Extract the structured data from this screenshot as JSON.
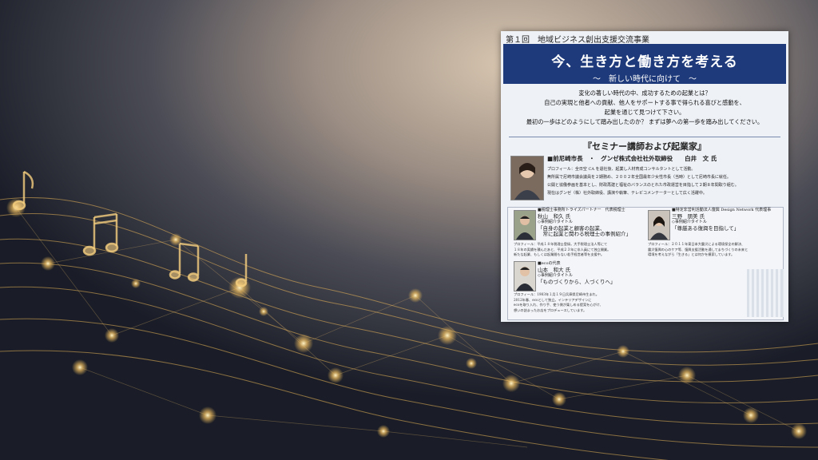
{
  "flyer": {
    "series_label": "第１回　地域ビジネス創出支援交流事業",
    "title": "今、生き方と働き方を考える",
    "subtitle": "～　新しい時代に向けて　～",
    "intro_lines": [
      "変化の著しい時代の中、成功するための起業とは？",
      "自己の実現と他者への貢献、他人をサポートする事で得られる喜びと感動を、",
      "起業を通じて見つけて下さい。",
      "最初の一歩はどのようにして踏み出したのか？ まずは夢への第一歩を踏み出してください。"
    ],
    "section_title": "『セミナー講師および起業家』",
    "main_speaker": {
      "heading": "■前尼崎市長　・　グンゼ株式会社社外取締役　　白井　文 氏",
      "profile_lines": [
        "プロフィール：全日空 CA を退社後、起業し人材育成コンサルタントとして活動。",
        "無所属で尼崎市議会議員を２期務め、２００２年全国最年少女性市長（当時）として尼崎市長に就任。",
        "公開と協働参画を基本とし、財政再建と福祉のバランスのとれた市政運営を目指して２期８年間取り組む。",
        "現在はグンゼ（株）社外取締役、講演や執筆、テレビコメンテーターとして広く活躍中。"
      ]
    },
    "speakers": [
      {
        "role": "■税理士事務所トライズパートナー　代表税理士",
        "name": "秋山　和久 氏",
        "topic_label": "◇事例紹介タイトル",
        "topic": "「自身の起業と顧客の起業、\n　常に起業と関わる税理士の事例紹介」",
        "profile": "プロフィール：平成１８年税理士登録。大手税理士法人等にて\n１８年の実績を積んだあと、平成２３年に非人員にて独立開業。\n新たな起業、もしくは起業間もない若手経営者等を支援中。"
      },
      {
        "role": "■特定非営利活動法人復興 Design Network 代表理事",
        "name": "三野　朋美 氏",
        "topic_label": "◇事例紹介タイトル",
        "topic": "「尊厳ある復興を目指して」",
        "profile": "プロフィール：２０１１年東日本大震災による環境保全の解決、\n震災復興の心のケア等、復興支援活動を通してまちづくりの未来と\n環境を考えながら「生きる」とは何かを模索しています。"
      },
      {
        "role": "■ecoの代表",
        "name": "山本　和大 氏",
        "topic_label": "◇事例紹介タイトル",
        "topic": "「ものづくりから、人づくりへ」",
        "profile": "プロフィール：1983年１月１９日兵庫県尼崎市生まれ。\n2012年春、ecoとして独立。インテリアデザインに\necoを取り入れ、作り手、使う側が楽しめる提案を心がけ、\n想いの詰まったお店をプロデュースしています。"
      }
    ]
  }
}
